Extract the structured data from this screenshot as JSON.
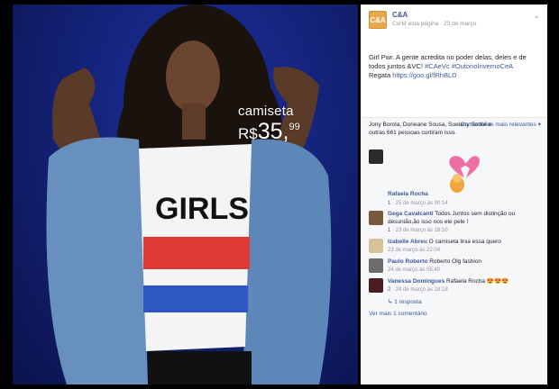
{
  "post": {
    "page_name": "C&A",
    "meta": "Curtir esta página · 23 de março ·",
    "logo_text": "C&A",
    "caption_text": "Girl Pwr. A gente acredita no poder delas, deles e de todos juntos &VC!",
    "caption_tags": "#CAeVc #OutonoInvernoCeA",
    "caption_line3": "Regata ",
    "caption_link": "https://goo.gl/fRhBLD"
  },
  "photo": {
    "price_label": "camiseta",
    "price_currency": "R$",
    "price_int": "35,",
    "price_dec": "99",
    "shirt_text": "GIRLS"
  },
  "likes": {
    "names": "Jony Borola, Dorieane Sousa, Suelany Sodré e",
    "others": "outras 661 pessoas curtiram isso.",
    "sort_label": "Comentários mais relevantes ▾"
  },
  "comments": [
    {
      "name": "Rafaela Rocha",
      "text": "",
      "meta_like": "1",
      "meta_time": "· 25 de março às 00:14",
      "avatar": "#2b2b2b"
    },
    {
      "name": "Gega Cavalcanti",
      "text": "Todos Juntos sem distinção ou desunião,ão isso nos ele pele !",
      "meta_like": "1",
      "meta_time": "· 23 de março às 18:10",
      "avatar": "#7a5a3c"
    },
    {
      "name": "Izabelle Abreu",
      "text": "O camiseta linia essa quero",
      "meta_like": "",
      "meta_time": "23 de março às 22:04",
      "avatar": "#d8c29a"
    },
    {
      "name": "Paulo Roberto",
      "text": "Roberto Olg fashion",
      "meta_like": "",
      "meta_time": "24 de março às 05:40",
      "avatar": "#6d6d6d"
    },
    {
      "name": "Vanessa Domingues",
      "text": "Rafaela Rocha 😍😍😍",
      "meta_like": "2",
      "meta_time": "· 24 de março às 18:18",
      "avatar": "#4a1d22"
    }
  ],
  "reply_label": "↳ 1 resposta",
  "more_label": "Ver mais 1 comentário"
}
